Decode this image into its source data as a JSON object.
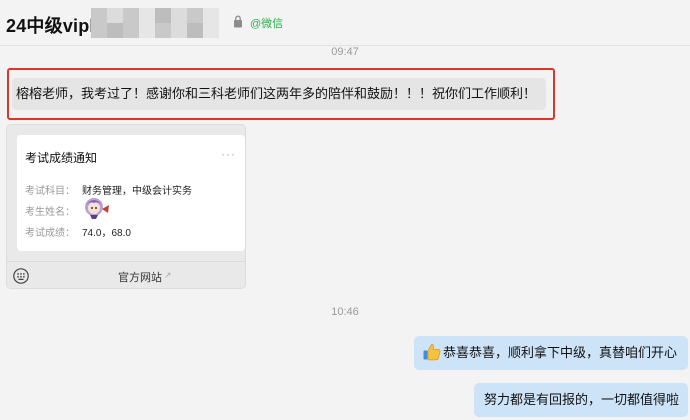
{
  "header": {
    "title": "24中级vipl",
    "source_label": "@微信",
    "source_color": "#28b04a"
  },
  "messages": {
    "time_1": "09:47",
    "received_text": "榕榕老师，我考过了！感谢你和三科老师们这两年多的陪伴和鼓励！！！祝你们工作顺利！",
    "card": {
      "title": "考试成绩通知",
      "more": "···",
      "subject_label": "考试科目：",
      "subject_value": "财务管理，中级会计实务",
      "name_label": "考生姓名：",
      "score_label": "考试成绩：",
      "score_value": "74.0，68.0",
      "footer_link": "官方网站",
      "link_glyph": "↗"
    },
    "time_2": "10:46",
    "sent_1": "恭喜恭喜，顺利拿下中级，真替咱们开心",
    "sent_2": "努力都是有回报的，一切都值得啦"
  },
  "icons": {
    "lock": "lock-icon",
    "thumb": "thumbs-up-icon",
    "keyboard": "keyboard-icon",
    "avatar": "avatar-sticker-icon"
  },
  "colors": {
    "highlight_border": "#e0342b",
    "sent_bubble": "#cde3f8",
    "received_bubble": "#e5e5e5"
  }
}
